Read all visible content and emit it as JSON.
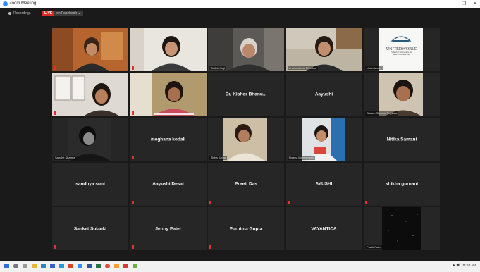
{
  "window": {
    "title": "Zoom Meeting"
  },
  "toolbar": {
    "recording_label": "Recording...",
    "live_badge": "LIVE",
    "live_destination": "on Facebook ⌄"
  },
  "participants": [
    {
      "display": "",
      "label": ""
    },
    {
      "display": "",
      "label": ""
    },
    {
      "display": "",
      "label": "Sudhir Jogi"
    },
    {
      "display": "",
      "label": "Unnikrishnan Bhaskar"
    },
    {
      "display": "",
      "label": "Unitedworld"
    },
    {
      "display": "",
      "label": ""
    },
    {
      "display": "",
      "label": ""
    },
    {
      "display": "Dr. Kishor Bhanu...",
      "label": ""
    },
    {
      "display": "Aayushi",
      "label": ""
    },
    {
      "display": "",
      "label": "Bikram Sharma Sapkota"
    },
    {
      "display": "",
      "label": "Sanchit Sharma"
    },
    {
      "display": "meghana kodali",
      "label": ""
    },
    {
      "display": "",
      "label": "Tisha Kotha"
    },
    {
      "display": "",
      "label": "Shreya Maheshwari"
    },
    {
      "display": "Nitika Samani",
      "label": ""
    },
    {
      "display": "sandhya soni",
      "label": ""
    },
    {
      "display": "Aayushi Desai",
      "label": ""
    },
    {
      "display": "Preeti Das",
      "label": ""
    },
    {
      "display": "AYUSHI",
      "label": ""
    },
    {
      "display": "shikha gurnani",
      "label": ""
    },
    {
      "display": "Sanket Solanki",
      "label": ""
    },
    {
      "display": "Jenny Patel",
      "label": ""
    },
    {
      "display": "Purnima Gupta",
      "label": ""
    },
    {
      "display": "VAYANTICA",
      "label": ""
    },
    {
      "display": "",
      "label": "Pratik Patel"
    }
  ],
  "logo": {
    "line1": "UNITEDWORLD",
    "line2": "School of Liberal Arts and Mass Communication"
  },
  "tray": {
    "time": "11:54 AM"
  },
  "colors": {
    "active_speaker": "#d8e04a",
    "muted": "#e03030",
    "live": "#e02828"
  }
}
